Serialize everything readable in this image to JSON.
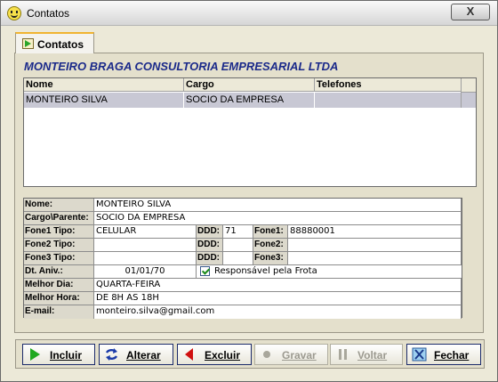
{
  "window": {
    "title": "Contatos",
    "close_label": "X"
  },
  "tab": {
    "label": "Contatos"
  },
  "company_name": "MONTEIRO BRAGA CONSULTORIA EMPRESARIAL LTDA",
  "grid": {
    "columns": [
      "Nome",
      "Cargo",
      "Telefones"
    ],
    "rows": [
      {
        "nome": "MONTEIRO SILVA",
        "cargo": "SOCIO DA EMPRESA",
        "telefones": ""
      }
    ]
  },
  "form": {
    "nome_label": "Nome:",
    "nome_value": "MONTEIRO SILVA",
    "cargo_label": "Cargo\\Parente:",
    "cargo_value": "SOCIO DA EMPRESA",
    "fone1_tipo_label": "Fone1 Tipo:",
    "fone1_tipo_value": "CELULAR",
    "ddd1_label": "DDD:",
    "ddd1_value": "71",
    "fone1_label": "Fone1:",
    "fone1_value": "88880001",
    "fone2_tipo_label": "Fone2 Tipo:",
    "fone2_tipo_value": "",
    "ddd2_label": "DDD:",
    "ddd2_value": "",
    "fone2_label": "Fone2:",
    "fone2_value": "",
    "fone3_tipo_label": "Fone3 Tipo:",
    "fone3_tipo_value": "",
    "ddd3_label": "DDD:",
    "ddd3_value": "",
    "fone3_label": "Fone3:",
    "fone3_value": "",
    "aniv_label": "Dt. Aniv.:",
    "aniv_value": "01/01/70",
    "frota_label": "Responsável pela Frota",
    "frota_checked": true,
    "dia_label": "Melhor Dia:",
    "dia_value": "QUARTA-FEIRA",
    "hora_label": "Melhor Hora:",
    "hora_value": "DE 8H AS 18H",
    "email_label": "E-mail:",
    "email_value": "monteiro.silva@gmail.com"
  },
  "buttons": {
    "incluir": "Incluir",
    "alterar": "Alterar",
    "excluir": "Excluir",
    "gravar": "Gravar",
    "voltar": "Voltar",
    "fechar": "Fechar"
  },
  "colors": {
    "company": "#1b2a8a",
    "accent_green": "#1fa81f",
    "accent_red": "#d01010",
    "accent_blue": "#1a3aa8"
  }
}
